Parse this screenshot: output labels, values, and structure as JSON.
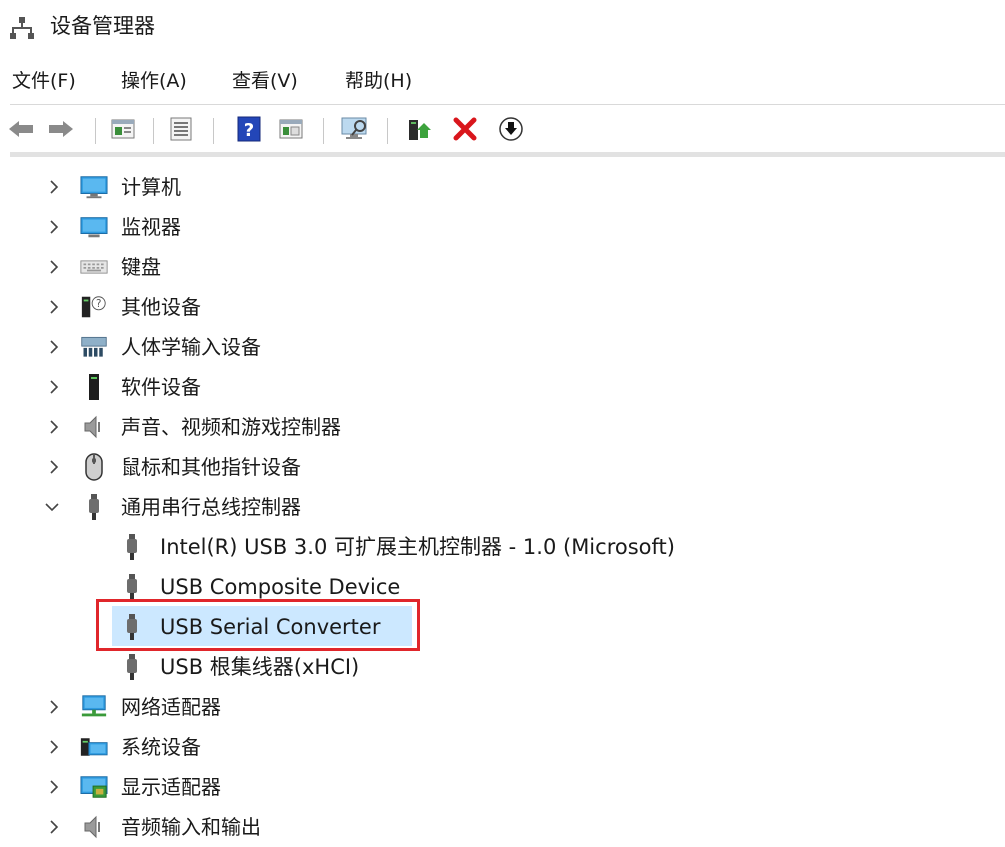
{
  "window": {
    "title": "设备管理器"
  },
  "menu": [
    {
      "label": "文件(F)"
    },
    {
      "label": "操作(A)"
    },
    {
      "label": "查看(V)"
    },
    {
      "label": "帮助(H)"
    }
  ],
  "toolbar": {
    "buttons": [
      "back-icon",
      "forward-icon",
      "properties-icon",
      "list-icon",
      "help-icon",
      "view-icon",
      "scan-hardware-icon",
      "update-driver-icon",
      "uninstall-icon",
      "download-icon"
    ]
  },
  "tree": {
    "categories": [
      {
        "label": "计算机",
        "expanded": false,
        "icon": "computer-icon"
      },
      {
        "label": "监视器",
        "expanded": false,
        "icon": "monitor-icon"
      },
      {
        "label": "键盘",
        "expanded": false,
        "icon": "keyboard-icon"
      },
      {
        "label": "其他设备",
        "expanded": false,
        "icon": "unknown-device-icon"
      },
      {
        "label": "人体学输入设备",
        "expanded": false,
        "icon": "hid-icon"
      },
      {
        "label": "软件设备",
        "expanded": false,
        "icon": "software-device-icon"
      },
      {
        "label": "声音、视频和游戏控制器",
        "expanded": false,
        "icon": "speaker-icon"
      },
      {
        "label": "鼠标和其他指针设备",
        "expanded": false,
        "icon": "mouse-icon"
      },
      {
        "label": "通用串行总线控制器",
        "expanded": true,
        "icon": "usb-icon"
      },
      {
        "label": "网络适配器",
        "expanded": false,
        "icon": "network-icon"
      },
      {
        "label": "系统设备",
        "expanded": false,
        "icon": "system-device-icon"
      },
      {
        "label": "显示适配器",
        "expanded": false,
        "icon": "display-adapter-icon"
      },
      {
        "label": "音频输入和输出",
        "expanded": false,
        "icon": "audio-io-icon"
      }
    ],
    "usb_children": [
      {
        "label": "Intel(R) USB 3.0 可扩展主机控制器 - 1.0 (Microsoft)"
      },
      {
        "label": "USB Composite Device"
      },
      {
        "label": "USB Serial Converter",
        "selected": true
      },
      {
        "label": "USB 根集线器(xHCI)"
      }
    ]
  },
  "colors": {
    "selection": "#cce8ff",
    "highlight_border": "#e0262b"
  }
}
